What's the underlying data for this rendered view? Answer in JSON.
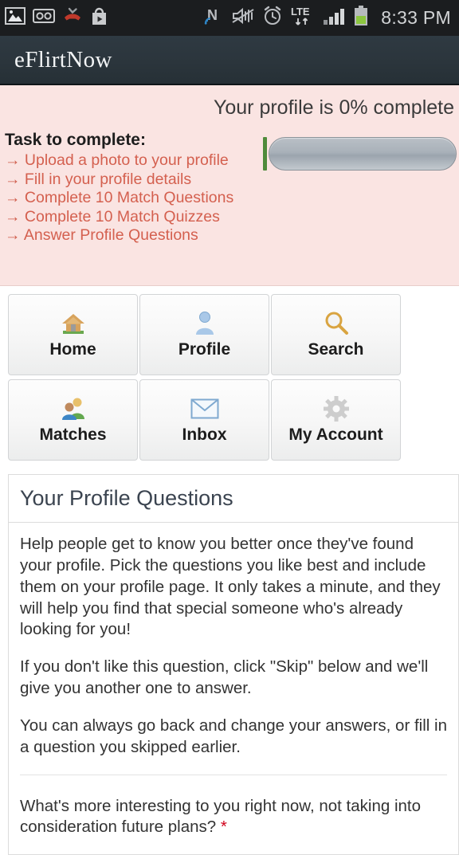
{
  "statusbar": {
    "time": "8:33 PM",
    "left_icons": [
      "image-icon",
      "voicemail-icon",
      "missed-call-icon",
      "play-store-icon"
    ],
    "right_icons": [
      "nfc-icon",
      "vibrate-mute-icon",
      "alarm-icon",
      "lte-icon",
      "signal-icon",
      "battery-icon"
    ],
    "network_label": "LTE"
  },
  "appbar": {
    "title": "eFlirtNow"
  },
  "promo": {
    "completion_text": "Your profile is 0% complete",
    "completion_percent": 0,
    "task_title": "Task to complete:",
    "arrow": "→",
    "tasks": [
      {
        "label": "Upload a photo to your profile"
      },
      {
        "label": "Fill in your profile details"
      },
      {
        "label": "Complete 10 Match Questions"
      },
      {
        "label": "Complete 10 Match Quizzes"
      },
      {
        "label": "Answer Profile Questions"
      }
    ],
    "link_color": "#d4604f",
    "bg_color": "#fae4e2",
    "progress_fill_color": "#4f8b3b"
  },
  "nav": {
    "items": [
      {
        "label": "Home",
        "icon": "house-icon"
      },
      {
        "label": "Profile",
        "icon": "person-icon"
      },
      {
        "label": "Search",
        "icon": "magnifier-icon"
      },
      {
        "label": "Matches",
        "icon": "people-group-icon"
      },
      {
        "label": "Inbox",
        "icon": "envelope-icon"
      },
      {
        "label": "My Account",
        "icon": "gear-icon"
      }
    ]
  },
  "panel": {
    "title": "Your Profile Questions",
    "paragraphs": [
      "Help people get to know you better once they've found your profile. Pick the questions you like best and include them on your profile page. It only takes a minute, and they will help you find that special someone who's already looking for you!",
      "If you don't like this question, click \"Skip\" below and we'll give you another one to answer.",
      "You can always go back and change your answers, or fill in a question you skipped earlier."
    ],
    "question_text": "What's more interesting to you right now, not taking into consideration future plans?",
    "required_marker": "*"
  }
}
